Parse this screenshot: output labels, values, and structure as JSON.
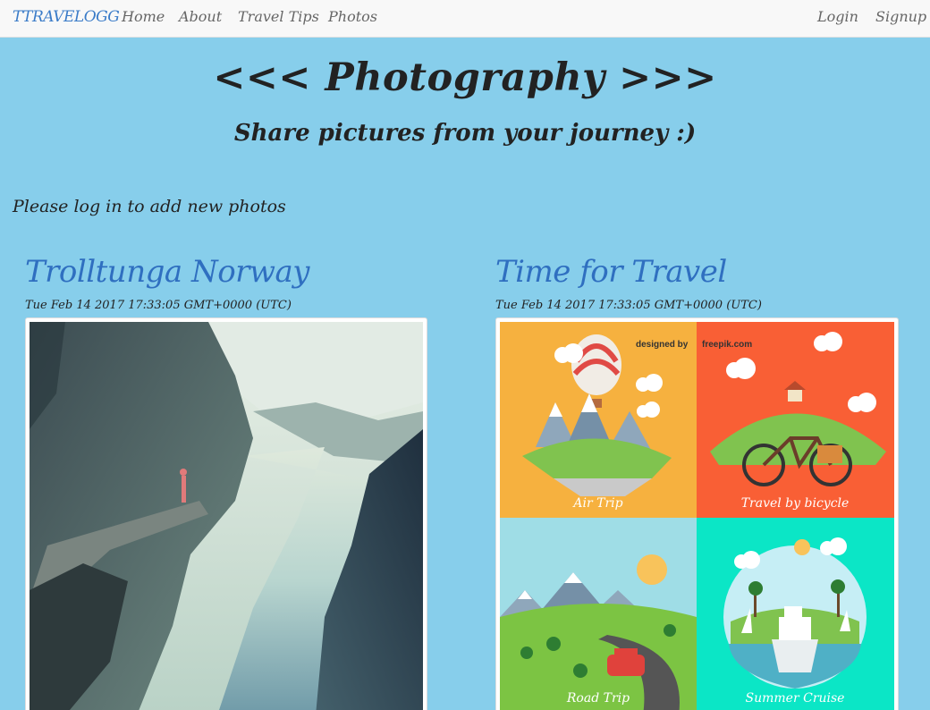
{
  "navbar": {
    "brand": "TTRAVELOGG",
    "links": [
      "Home",
      "About",
      "Travel Tips",
      "Photos"
    ],
    "login": "Login",
    "signup": "Signup"
  },
  "header": {
    "title": "<<< Photography >>>",
    "subtitle": "Share pictures from your journey :)"
  },
  "notice": "Please log in to add new photos",
  "posts": [
    {
      "title": "Trolltunga Norway",
      "date": "Tue Feb 14 2017 17:33:05 GMT+0000 (UTC)"
    },
    {
      "title": "Time for Travel",
      "date": "Tue Feb 14 2017 17:33:05 GMT+0000 (UTC)",
      "poster": {
        "credit": "designed by",
        "credit_brand": "freepik.com",
        "panels": [
          "Air Trip",
          "Travel by bicycle",
          "Road Trip",
          "Summer Cruise"
        ]
      }
    }
  ],
  "colors": {
    "background": "#87ceeb",
    "navbar": "#f8f8f8",
    "brand": "#3a7bc8",
    "post_title": "#2f6fc0",
    "poster_orange": "#f6b13f",
    "poster_red": "#f95f35",
    "poster_sky": "#9fdde6",
    "poster_teal": "#0be6c6"
  }
}
